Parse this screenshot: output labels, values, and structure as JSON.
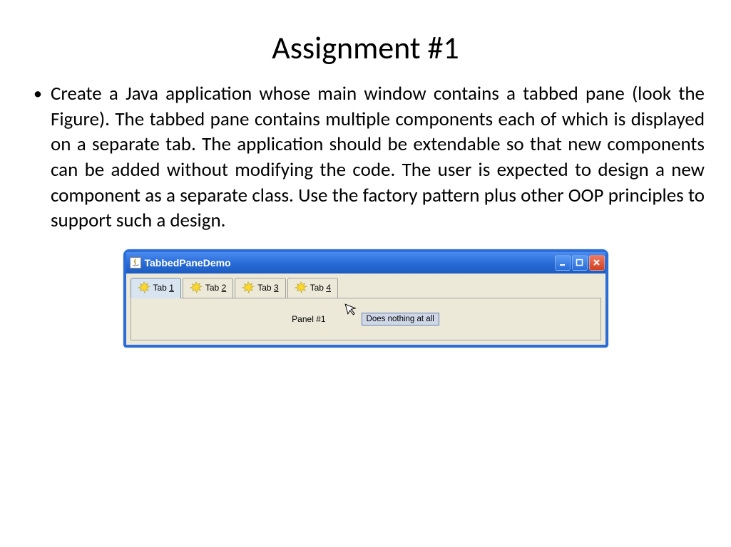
{
  "title": "Assignment #1",
  "bullet": "Create a Java application whose main window contains a tabbed pane (look the Figure). The tabbed pane contains multiple components each of which is displayed on a separate tab. The application should be extendable so that new components can be added without modifying the code. The user is expected to design a new component as a separate class. Use the factory pattern plus other OOP principles to support such a design.",
  "window": {
    "title": "TabbedPaneDemo",
    "tabs": [
      {
        "prefix": "Tab ",
        "num": "1"
      },
      {
        "prefix": "Tab ",
        "num": "2"
      },
      {
        "prefix": "Tab ",
        "num": "3"
      },
      {
        "prefix": "Tab ",
        "num": "4"
      }
    ],
    "panel_label": "Panel #1",
    "tooltip": "Does nothing at all",
    "controls": {
      "minimize": "_",
      "maximize": "□",
      "close": "×"
    }
  }
}
